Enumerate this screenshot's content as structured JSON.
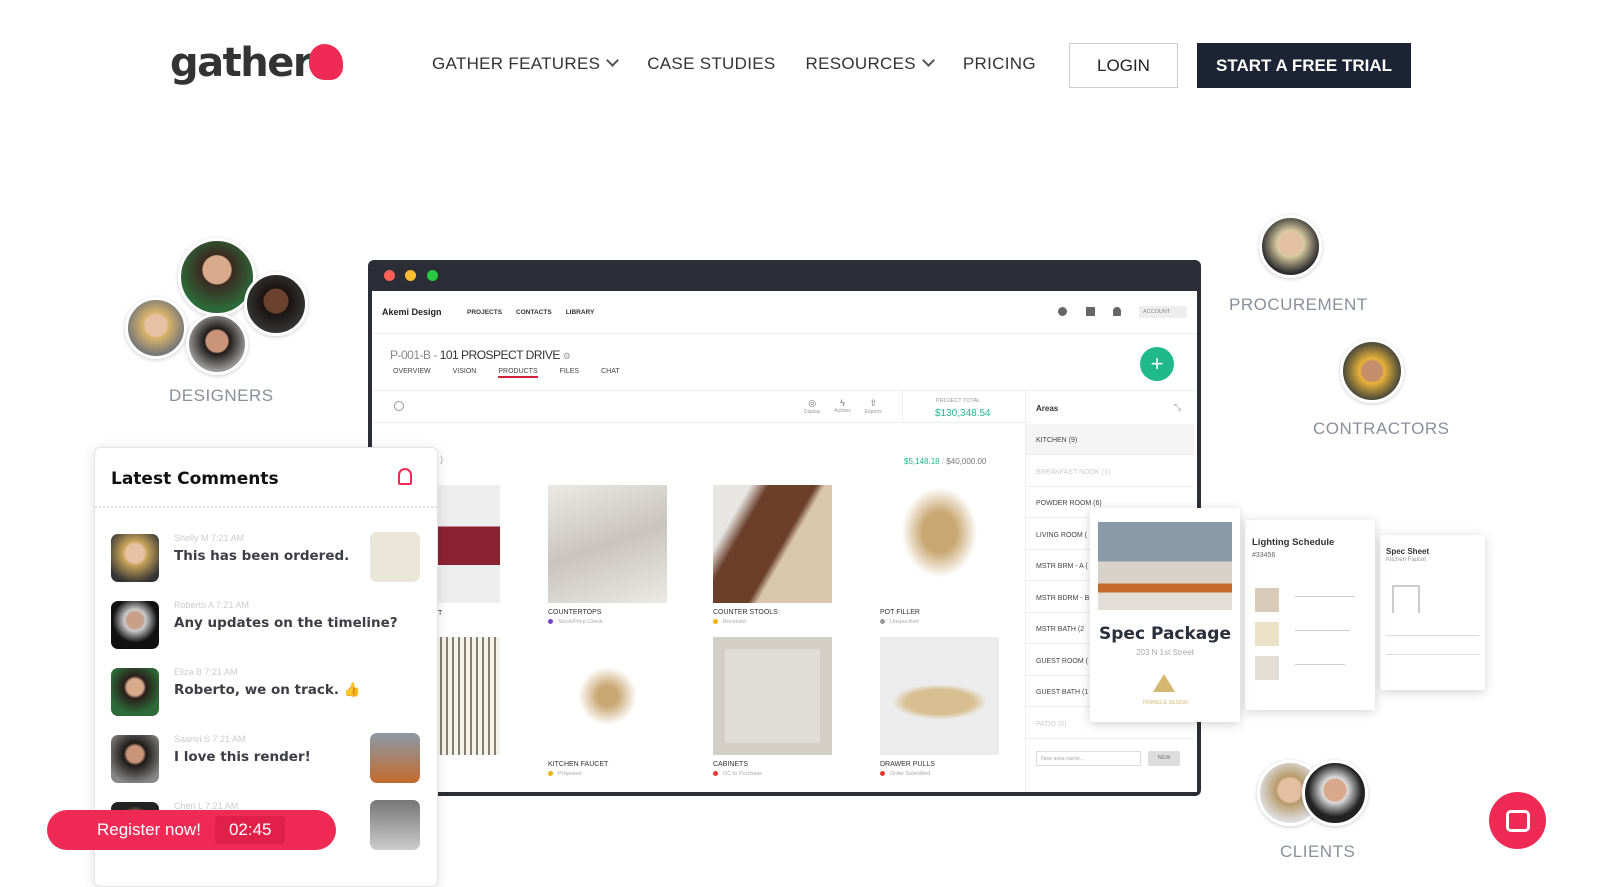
{
  "header": {
    "logo": "gather",
    "nav": [
      {
        "label": "GATHER FEATURES",
        "dropdown": true
      },
      {
        "label": "CASE STUDIES",
        "dropdown": false
      },
      {
        "label": "RESOURCES",
        "dropdown": true
      },
      {
        "label": "PRICING",
        "dropdown": false
      }
    ],
    "login": "LOGIN",
    "trial": "START A FREE TRIAL"
  },
  "roles": {
    "designers": "DESIGNERS",
    "procurement": "PROCUREMENT",
    "contractors": "CONTRACTORS",
    "clients": "CLIENTS"
  },
  "app": {
    "brand": "Akemi Design",
    "nav": [
      "PROJECTS",
      "CONTACTS",
      "LIBRARY"
    ],
    "account": "ACCOUNT",
    "project_code": "P-001-B - ",
    "project_name": "101 PROSPECT DRIVE",
    "tabs": [
      "OVERVIEW",
      "VISION",
      "PRODUCTS",
      "FILES",
      "CHAT"
    ],
    "active_tab": "PRODUCTS",
    "tools": [
      "Display",
      "Actions",
      "Exports"
    ],
    "total_label": "PROJECT TOTAL",
    "total": "$130,348.54",
    "budget_spent": "$5,148.18",
    "budget_total": "$40,000.00",
    "partial_heading": ")",
    "partial_label": "T",
    "products": [
      {
        "name": "COUNTERTOPS",
        "status": "Stock/Price Check",
        "color": "#7b3fd0"
      },
      {
        "name": "COUNTER STOOLS",
        "status": "Received",
        "color": "#f0b400"
      },
      {
        "name": "POT FILLER",
        "status": "Unspecified",
        "color": "#999999"
      },
      {
        "name": "KITCHEN FAUCET",
        "status": "Proposed",
        "color": "#f0b400"
      },
      {
        "name": "CABINETS",
        "status": "OC to Purchase",
        "color": "#e53935"
      },
      {
        "name": "DRAWER PULLS",
        "status": "Order Submitted",
        "color": "#e53935"
      }
    ],
    "areas_title": "Areas",
    "areas": [
      "KITCHEN (9)",
      "BREAKFAST NOOK (1)",
      "POWDER ROOM (6)",
      "LIVING ROOM (",
      "MSTR BRM - A (",
      "MSTR BDRM - B",
      "MSTR BATH (2",
      "GUEST ROOM (",
      "GUEST BATH (1",
      "PATIO (0)"
    ],
    "area_placeholder": "New area name...",
    "area_button": "NEW"
  },
  "docs": {
    "spec_title": "Spec Package",
    "spec_address": "203 N 1st Street",
    "spec_brand": "TRIANGLE DESIGN",
    "lighting_title": "Lighting Schedule",
    "lighting_number": "#33456",
    "sheet_title": "Spec Sheet",
    "sheet_sub": "Kitchen Faucet"
  },
  "comments": {
    "title": "Latest Comments",
    "items": [
      {
        "who": "Shelly M  7:21 AM",
        "text": "This has been ordered."
      },
      {
        "who": "Roberto A  7:21 AM",
        "text": "Any updates on the timeline?"
      },
      {
        "who": "Eliza B  7:21 AM",
        "text": "Roberto, we on track. 👍"
      },
      {
        "who": "Saanvi S  7:21 AM",
        "text": "I love this render!"
      },
      {
        "who": "Cheri L  7:21 AM",
        "text": ""
      }
    ]
  },
  "register": {
    "label": "Register now!",
    "timer": "02:45"
  },
  "colors": {
    "brand": "#ef2b55",
    "navy": "#1c2433",
    "green": "#1fb98a"
  }
}
